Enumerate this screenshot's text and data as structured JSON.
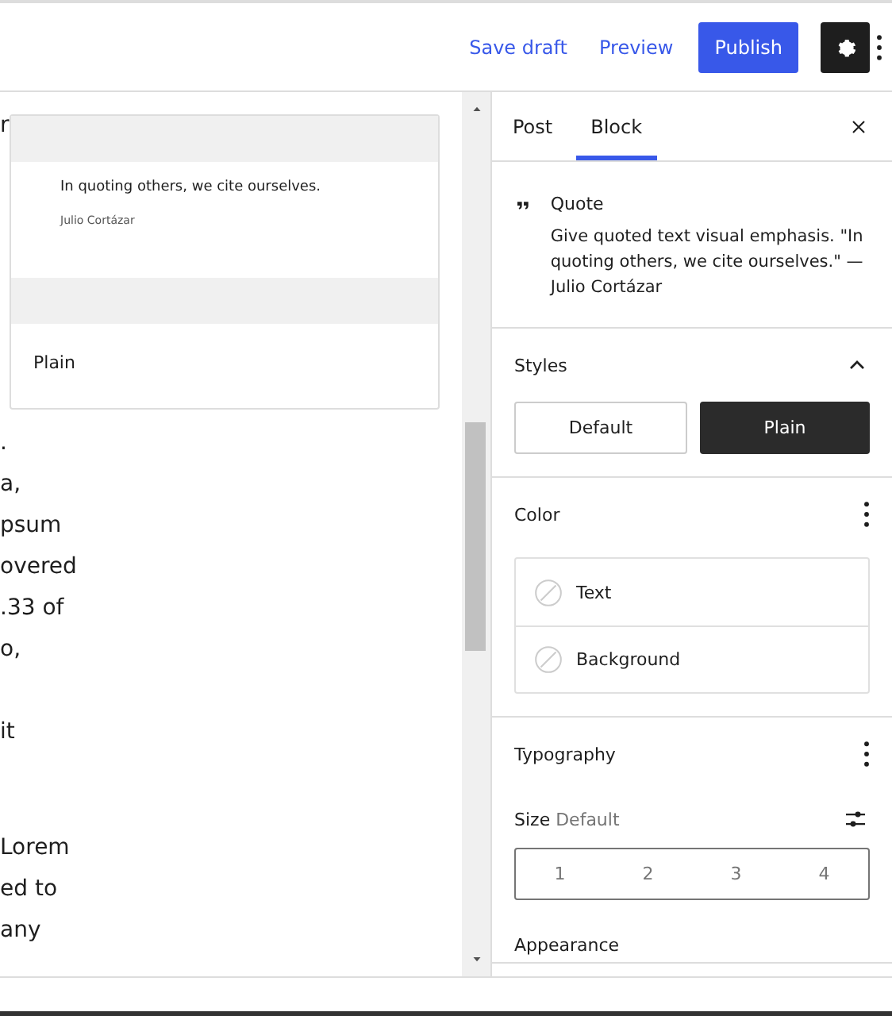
{
  "header": {
    "save_draft": "Save draft",
    "preview": "Preview",
    "publish": "Publish",
    "settings_pressed": true
  },
  "editor": {
    "top_line": "r",
    "paragraphs": [
      [
        ".",
        "a,",
        "psum",
        "overed",
        ".33 of",
        "o,"
      ],
      [
        "it"
      ],
      [
        "Lorem",
        "ed to",
        "any"
      ]
    ]
  },
  "style_preview": {
    "quote": "In quoting others, we cite ourselves.",
    "citation": "Julio Cortázar",
    "label": "Plain"
  },
  "sidebar": {
    "tabs": [
      {
        "label": "Post",
        "selected": false
      },
      {
        "label": "Block",
        "selected": true
      }
    ],
    "block": {
      "title": "Quote",
      "description": "Give quoted text visual emphasis. \"In quoting others, we cite ourselves.\" — Julio Cortázar"
    },
    "styles": {
      "title": "Styles",
      "expanded": true,
      "options": [
        {
          "label": "Default",
          "selected": false
        },
        {
          "label": "Plain",
          "selected": true
        }
      ]
    },
    "color": {
      "title": "Color",
      "items": [
        "Text",
        "Background"
      ]
    },
    "typography": {
      "title": "Typography",
      "size_label": "Size",
      "size_value": "Default",
      "sizes": [
        "1",
        "2",
        "3",
        "4"
      ],
      "appearance": "Appearance"
    }
  }
}
